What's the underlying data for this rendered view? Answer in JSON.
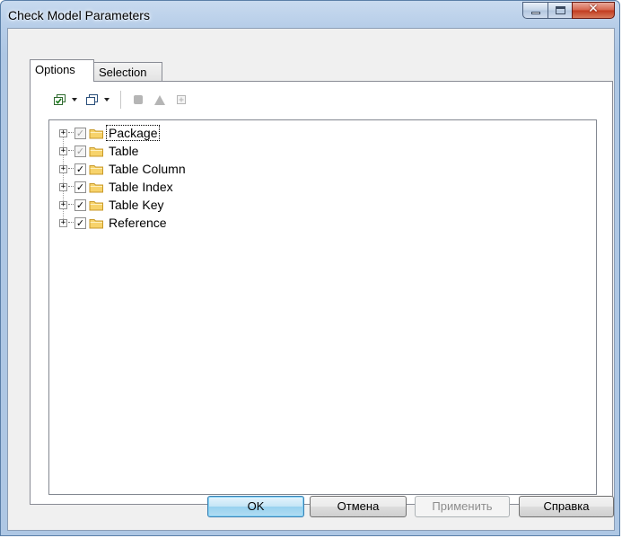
{
  "window": {
    "title": "Check Model Parameters",
    "accent_color": "#aec7e4"
  },
  "tabs": [
    {
      "label": "Options",
      "active": true
    },
    {
      "label": "Selection",
      "active": false
    }
  ],
  "toolbar": {
    "items": [
      {
        "icon": "select-all-icon",
        "has_dropdown": true,
        "enabled": true
      },
      {
        "icon": "deselect-all-icon",
        "has_dropdown": true,
        "enabled": true
      },
      {
        "icon": "stop-icon",
        "enabled": false
      },
      {
        "icon": "warning-icon",
        "enabled": false
      },
      {
        "icon": "expand-all-icon",
        "enabled": false
      }
    ]
  },
  "tree": {
    "items": [
      {
        "label": "Package",
        "check_state": "grayed",
        "focused": true
      },
      {
        "label": "Table",
        "check_state": "grayed",
        "focused": false
      },
      {
        "label": "Table Column",
        "check_state": "checked",
        "focused": false
      },
      {
        "label": "Table Index",
        "check_state": "checked",
        "focused": false
      },
      {
        "label": "Table Key",
        "check_state": "checked",
        "focused": false
      },
      {
        "label": "Reference",
        "check_state": "checked",
        "focused": false
      }
    ]
  },
  "buttons": {
    "ok": "OK",
    "cancel": "Отмена",
    "apply": "Применить",
    "help": "Справка"
  }
}
